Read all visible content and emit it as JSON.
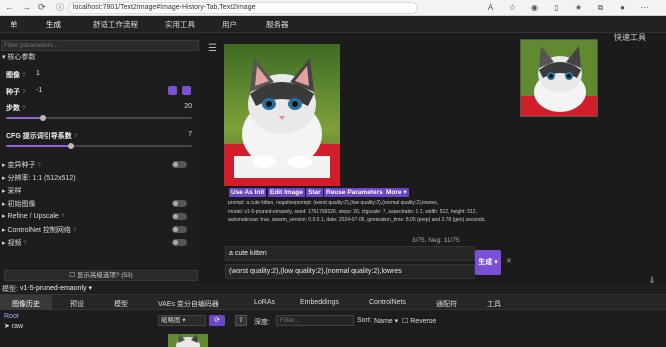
{
  "browser": {
    "url": "localhost:7801/Text2Image#Image-History-Tab,Text2Image",
    "icons": [
      "back-icon",
      "forward-icon",
      "refresh-icon",
      "info-icon",
      "translate-icon",
      "favorite-icon",
      "extension-icon",
      "split-icon",
      "sidebar-icon",
      "collections-icon",
      "profile-icon",
      "more-icon"
    ]
  },
  "appnav": {
    "tabs": [
      "单",
      "生成",
      "舒适工作流程",
      "实用工具",
      "用户",
      "服务器"
    ],
    "active": 1
  },
  "left": {
    "filter_placeholder": "Filter parameters...",
    "section_core": "核心参数",
    "params": {
      "images_label": "图像",
      "images_value": "1",
      "seed_label": "种子",
      "seed_value": "-1",
      "steps_label": "步数",
      "steps_value": "20",
      "steps_fraction": 0.2,
      "cfg_label": "CFG 提示词引导系数",
      "cfg_value": "7",
      "cfg_fraction": 0.35
    },
    "groups": [
      "变异种子",
      "分辨率: 1:1 (512x512)",
      "采样",
      "初始图像",
      "Refine / Upscale",
      "ControlNet 控制网络",
      "视频"
    ],
    "show_advanced": "显示高级选项? (53)"
  },
  "center": {
    "action_buttons": [
      "Use As Init",
      "Edit Image",
      "Star",
      "Reuse Parameters",
      "More ▾"
    ],
    "info_lines": [
      "prompt: a cute kitten, negativeprompt: (worst quality:2),(low quality:2),(normal quality:2),lowres,",
      "model: v1-5-pruned-emaonly, seed: 1761799326, steps: 20, cfgscale: 7, aspectratio: 1:1, width: 512, height: 512,",
      "automaticvae: true, swarm_version: 0.9.0.1, date: 2024-07-06, generation_time: 8.05 (prep) and 2.78 (gen) seconds,"
    ],
    "counter": "3/75, Neg: 11/75",
    "prompt": "a cute kitten",
    "negative_prompt": "(worst quality:2),(low quality:2),(normal quality:2),lowres",
    "generate_label": "生成 ▾",
    "close_label": "✕"
  },
  "right": {
    "quick_tools": "快速工具"
  },
  "modelbar": {
    "label": "模型:",
    "value": "v1-5-pruned-emaonly",
    "arrow": "▾"
  },
  "bottom_tabs": {
    "tabs": [
      "图像历史",
      "预设",
      "模型",
      "VAEs 变分自编码器",
      "LoRAs",
      "Embeddings",
      "ControlNets",
      "通配符",
      "工具"
    ],
    "active": 0
  },
  "history": {
    "tree_root": "Root",
    "tree_child": "raw",
    "view_select": "缩略图",
    "depth_label": "深度:",
    "filter_placeholder": "Filter...",
    "sort_label": "Sort:",
    "sort_value": "Name",
    "reverse_label": "Reverse"
  },
  "colors": {
    "accent": "#7a50d8",
    "background": "#1b1b1b"
  }
}
